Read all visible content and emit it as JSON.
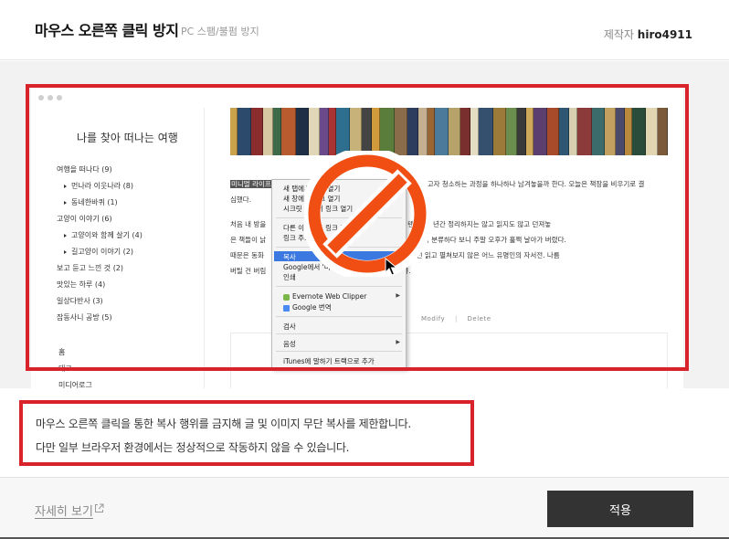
{
  "header": {
    "title": "마우스 오른쪽 클릭 방지",
    "subtitle": "PC 스팸/불펌 방지",
    "author_label": "제작자",
    "author_name": "hiro4911"
  },
  "preview": {
    "blog_title": "나를 찾아 떠나는 여행",
    "categories": [
      {
        "label": "여행을 떠나다 (9)",
        "sub": false
      },
      {
        "label": "먼나라 이웃나라 (8)",
        "sub": true
      },
      {
        "label": "동네한바퀴 (1)",
        "sub": true
      },
      {
        "label": "고양이 이야기 (6)",
        "sub": false
      },
      {
        "label": "고양이와 함께 살기 (4)",
        "sub": true
      },
      {
        "label": "길고양이 이야기 (2)",
        "sub": true
      },
      {
        "label": "보고 듣고 느낀 것 (2)",
        "sub": false
      },
      {
        "label": "맛있는 하루 (4)",
        "sub": false
      },
      {
        "label": "일상다반사 (3)",
        "sub": false
      },
      {
        "label": "잡동사니 공방 (5)",
        "sub": false
      }
    ],
    "menu_links": [
      "홈",
      "태그",
      "미디어로그"
    ],
    "para1_hl": "미니멀 라이프",
    "para1_a": "…고자 청소하는 과정을 하나하나 남겨놓을까 한다. 오늘은 책장을 비우기로 결",
    "para1_b": "심했다.",
    "para2_lines": [
      "처음 내 방을                         인 오        서재의 이미지였을 텐데. 몇 년간 정리하지는 않고 읽지도 않고 던져놓",
      "은 책들이 낡                              는 기      로 책을 한 권 두 권 꺼내 분류하다 보니 주말 오후가 훌쩍 날아가 버렸다.",
      "때문은 동화                             짐        싸후강 숙제 때문에 한 번 읽고 펼쳐보지 않은 어느 유명인의 자서전. 나름",
      "버틸 건 버림                                              다 많을 줄이야."
    ],
    "modify_label": "Modify",
    "delete_label": "Delete",
    "context_menu": [
      "새 탭에서 링크 열기",
      "새 창에서 링크 열기",
      "시크릿 창에서 링크 열기",
      "다른 이름으로 링크 저장...",
      "링크 주소 복사",
      "복사",
      "Google에서 '미니멀 라이프' 검색",
      "인쇄",
      "Evernote Web Clipper",
      "Google 번역",
      "검사",
      "음성",
      "iTunes에 말하기 트랙으로 추가"
    ]
  },
  "notice": {
    "line1": "마우스 오른쪽 클릭을 통한 복사 행위를 금지해 글 및 이미지 무단 복사를 제한합니다.",
    "line2": "다만 일부 브라우저 환경에서는 정상적으로 작동하지 않을 수 있습니다."
  },
  "footer": {
    "detail_link": "자세히 보기",
    "apply_button": "적용"
  },
  "colors": {
    "highlight_red": "#d9232b",
    "ban_orange": "#f04e13",
    "button_dark": "#333333",
    "menu_selection": "#3b78e0"
  }
}
